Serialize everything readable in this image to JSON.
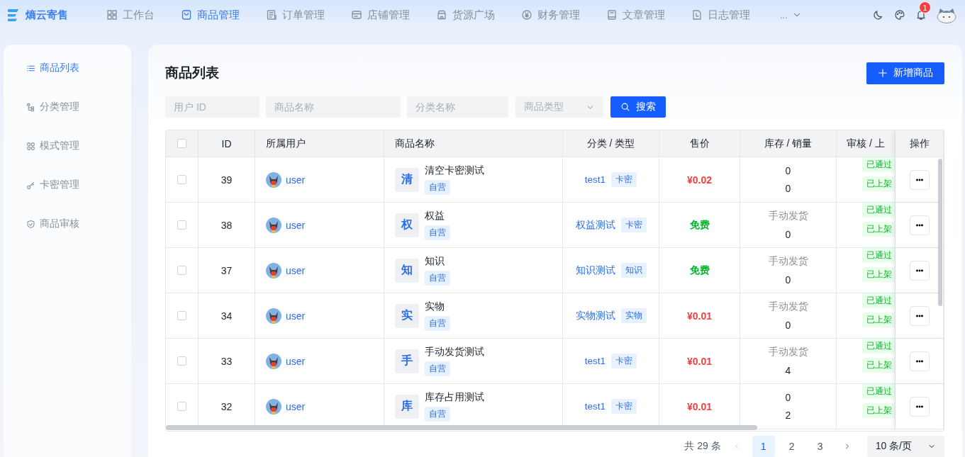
{
  "brand": "熵云寄售",
  "nav": [
    {
      "label": "工作台",
      "selected": false
    },
    {
      "label": "商品管理",
      "selected": true
    },
    {
      "label": "订单管理",
      "selected": false
    },
    {
      "label": "店铺管理",
      "selected": false
    },
    {
      "label": "货源广场",
      "selected": false
    },
    {
      "label": "财务管理",
      "selected": false
    },
    {
      "label": "文章管理",
      "selected": false
    },
    {
      "label": "日志管理",
      "selected": false
    }
  ],
  "nav_more": "...",
  "notifications": "1",
  "sidebar": {
    "items": [
      {
        "label": "商品列表",
        "selected": true
      },
      {
        "label": "分类管理",
        "selected": false
      },
      {
        "label": "模式管理",
        "selected": false
      },
      {
        "label": "卡密管理",
        "selected": false
      },
      {
        "label": "商品审核",
        "selected": false
      }
    ]
  },
  "page_title": "商品列表",
  "add_button": "新增商品",
  "filters": {
    "user_id": {
      "placeholder": "用户 ID"
    },
    "product_name": {
      "placeholder": "商品名称"
    },
    "category_name": {
      "placeholder": "分类名称"
    },
    "product_type": {
      "placeholder": "商品类型"
    },
    "search_button": "搜索"
  },
  "table": {
    "all_checked": false,
    "columns": [
      "ID",
      "所属用户",
      "商品名称",
      "分类 / 类型",
      "售价",
      "库存 / 销量",
      "审核 / 上",
      "操作"
    ],
    "rows": [
      {
        "checked": false,
        "id": "39",
        "user": "user",
        "initial": "清",
        "name": "清空卡密测试",
        "tag": "自营",
        "category": "test1",
        "type": "卡密",
        "price": "¥0.02",
        "free": false,
        "stock": "0",
        "manual_delivery": false,
        "sales": "0",
        "review": "已通过",
        "listing": "已上架"
      },
      {
        "checked": false,
        "id": "38",
        "user": "user",
        "initial": "权",
        "name": "权益",
        "tag": "自营",
        "category": "权益测试",
        "type": "卡密",
        "price": "免费",
        "free": true,
        "stock": "手动发货",
        "manual_delivery": true,
        "sales": "0",
        "review": "已通过",
        "listing": "已上架"
      },
      {
        "checked": false,
        "id": "37",
        "user": "user",
        "initial": "知",
        "name": "知识",
        "tag": "自营",
        "category": "知识测试",
        "type": "知识",
        "price": "免费",
        "free": true,
        "stock": "手动发货",
        "manual_delivery": true,
        "sales": "0",
        "review": "已通过",
        "listing": "已上架"
      },
      {
        "checked": false,
        "id": "34",
        "user": "user",
        "initial": "实",
        "name": "实物",
        "tag": "自营",
        "category": "实物测试",
        "type": "实物",
        "price": "¥0.01",
        "free": false,
        "stock": "手动发货",
        "manual_delivery": true,
        "sales": "0",
        "review": "已通过",
        "listing": "已上架"
      },
      {
        "checked": false,
        "id": "33",
        "user": "user",
        "initial": "手",
        "name": "手动发货测试",
        "tag": "自营",
        "category": "test1",
        "type": "卡密",
        "price": "¥0.01",
        "free": false,
        "stock": "手动发货",
        "manual_delivery": true,
        "sales": "4",
        "review": "已通过",
        "listing": "已上架"
      },
      {
        "checked": false,
        "id": "32",
        "user": "user",
        "initial": "库",
        "name": "库存占用测试",
        "tag": "自营",
        "category": "test1",
        "type": "卡密",
        "price": "¥0.01",
        "free": false,
        "stock": "0",
        "manual_delivery": false,
        "sales": "2",
        "review": "已通过",
        "listing": "已上架"
      }
    ]
  },
  "pagination": {
    "total": "共 29 条",
    "pages": [
      {
        "label": "1",
        "selected": true
      },
      {
        "label": "2",
        "selected": false
      },
      {
        "label": "3",
        "selected": false
      }
    ],
    "page_size": "10 条/页"
  }
}
